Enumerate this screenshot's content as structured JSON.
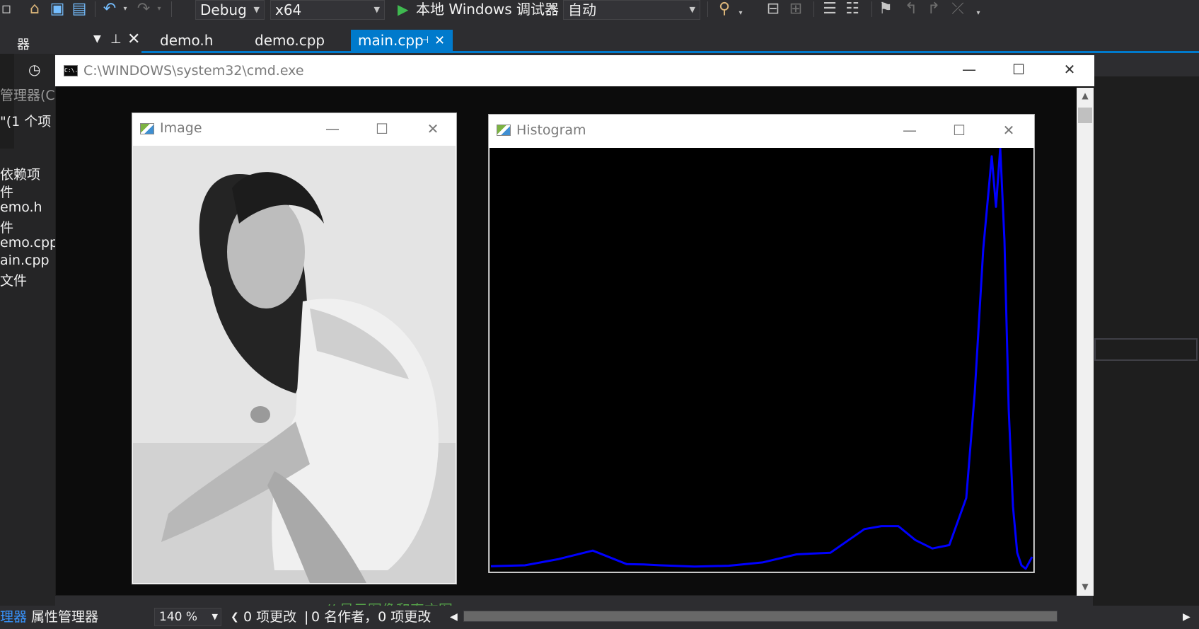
{
  "toolbar": {
    "config": "Debug",
    "platform": "x64",
    "run_label": "本地 Windows 调试器",
    "solution_config": "自动"
  },
  "doc_tabs": [
    {
      "label": "demo.h"
    },
    {
      "label": "demo.cpp"
    },
    {
      "label": "main.cpp",
      "active": true
    }
  ],
  "solution_explorer": {
    "header_fragment": "器",
    "subtitle_fragment": "管理器(C",
    "count_fragment": "\"(1 个项",
    "items": [
      "依赖项",
      "件",
      "emo.h",
      "件",
      "emo.cpp",
      "ain.cpp",
      "文件"
    ]
  },
  "cmd": {
    "title": "C:\\WINDOWS\\system32\\cmd.exe",
    "icon_text": "C:\\."
  },
  "image_window": {
    "title": "Image"
  },
  "histogram_window": {
    "title": "Histogram"
  },
  "status": {
    "tab1_fragment": "理器",
    "tab2": "属性管理器",
    "zoom": "140 %",
    "changes": "0 项更改",
    "authors": "0 名作者，0 项更改",
    "code_fragment": "// 显示图像和直方图"
  },
  "chart_data": {
    "type": "line",
    "title": "",
    "xlabel": "",
    "ylabel": "",
    "series": [
      {
        "color": "#0000ff",
        "x": [
          0,
          16,
          32,
          48,
          64,
          72,
          80,
          96,
          112,
          128,
          144,
          160,
          176,
          184,
          192,
          200,
          208,
          216,
          224,
          228,
          232,
          236,
          238,
          240,
          242,
          244,
          246,
          248,
          250,
          252,
          255
        ],
        "values": [
          0.008,
          0.01,
          0.025,
          0.045,
          0.013,
          0.012,
          0.01,
          0.007,
          0.009,
          0.017,
          0.036,
          0.04,
          0.096,
          0.103,
          0.103,
          0.07,
          0.05,
          0.058,
          0.17,
          0.42,
          0.76,
          0.98,
          0.86,
          1.0,
          0.78,
          0.38,
          0.15,
          0.04,
          0.01,
          0.002,
          0.03
        ]
      }
    ]
  }
}
